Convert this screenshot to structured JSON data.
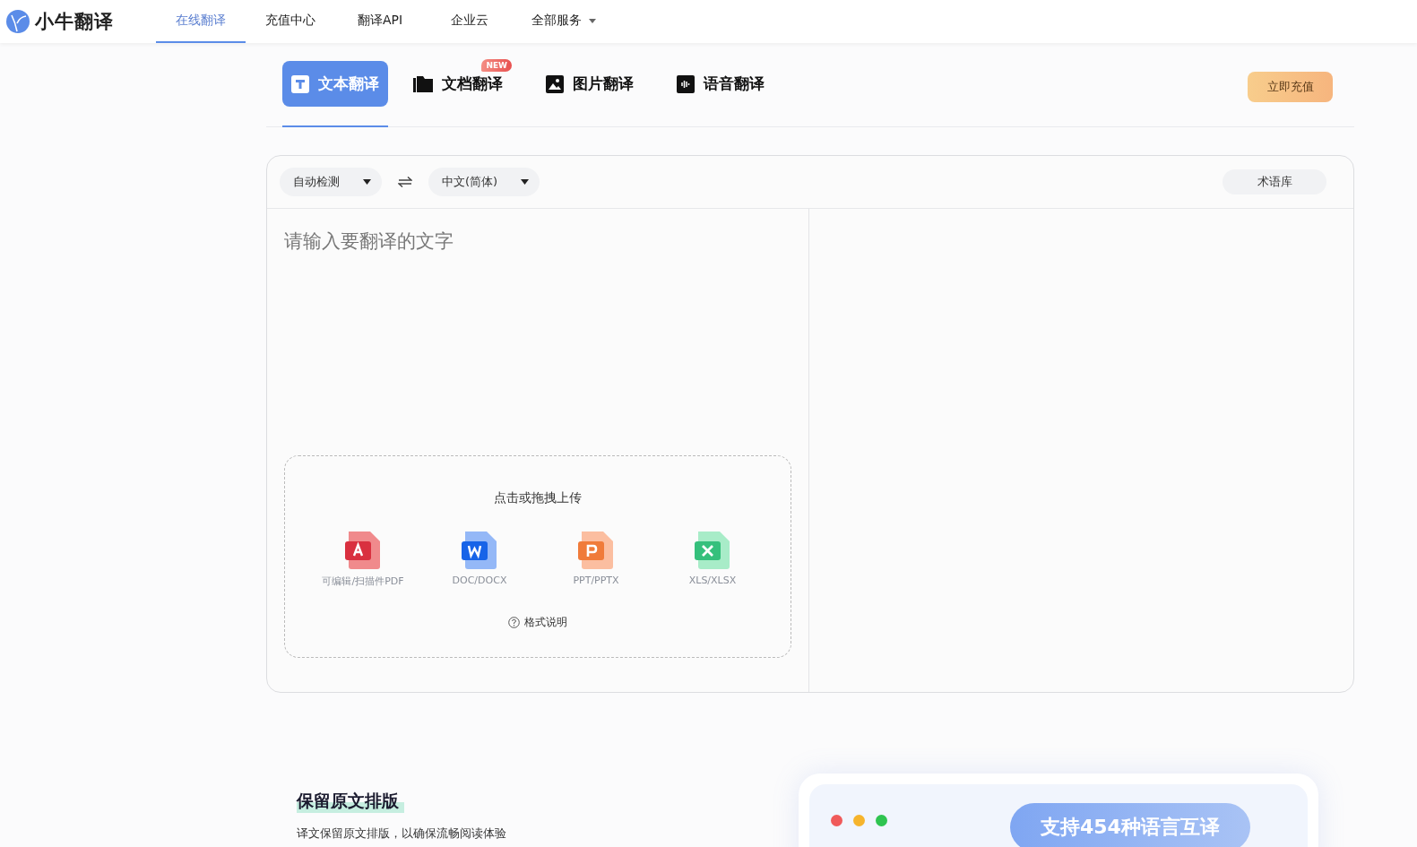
{
  "logo": {
    "text": "小牛翻译"
  },
  "nav": [
    {
      "label": "在线翻译",
      "selected": true,
      "dropdown": false
    },
    {
      "label": "充值中心",
      "selected": false,
      "dropdown": false
    },
    {
      "label": "翻译API",
      "selected": false,
      "dropdown": false
    },
    {
      "label": "企业云",
      "selected": false,
      "dropdown": false
    },
    {
      "label": "全部服务",
      "selected": false,
      "dropdown": true
    }
  ],
  "tabs": [
    {
      "label": "文本翻译",
      "kind": "text",
      "selected": true
    },
    {
      "label": "文档翻译",
      "kind": "document",
      "selected": false,
      "badge": "NEW"
    },
    {
      "label": "图片翻译",
      "kind": "image",
      "selected": false
    },
    {
      "label": "语音翻译",
      "kind": "audio",
      "selected": false
    }
  ],
  "recharge_button": "立即充值",
  "translator": {
    "source_language": "自动检测",
    "target_language": "中文(简体)",
    "glossary_button": "术语库",
    "placeholder": "请输入要翻译的文字",
    "upload": {
      "title": "点击或拖拽上传",
      "file_types": [
        {
          "label": "可编辑/扫描件PDF",
          "kind": "pdf"
        },
        {
          "label": "DOC/DOCX",
          "kind": "word"
        },
        {
          "label": "PPT/PPTX",
          "kind": "ppt"
        },
        {
          "label": "XLS/XLSX",
          "kind": "excel"
        }
      ],
      "format_help": "格式说明"
    }
  },
  "feature": {
    "title": "保留原文排版",
    "description": "译文保留原文排版，以确保流畅阅读体验"
  },
  "promo": {
    "pill": "支持454种语言互译"
  }
}
